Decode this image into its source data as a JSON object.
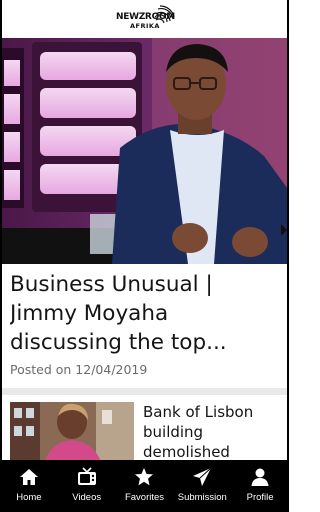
{
  "app": {
    "logo_line1": "NEWZROOM",
    "logo_line2": "AFRIKA"
  },
  "featured": {
    "title": "Business Unusual | Jimmy Moyaha discussing the top...",
    "posted": "Posted on 12/04/2019"
  },
  "articles": [
    {
      "title": "Bank of Lisbon building demolished"
    }
  ],
  "nav": [
    {
      "label": "Home",
      "icon": "home-icon"
    },
    {
      "label": "Videos",
      "icon": "tv-icon"
    },
    {
      "label": "Favorites",
      "icon": "star-icon"
    },
    {
      "label": "Submission",
      "icon": "send-icon"
    },
    {
      "label": "Profile",
      "icon": "user-icon"
    }
  ],
  "colors": {
    "nav_background": "#000000",
    "nav_text": "#ffffff",
    "headline_text": "#151515",
    "meta_text": "#6b6b6b",
    "divider": "#e9e9e9"
  }
}
